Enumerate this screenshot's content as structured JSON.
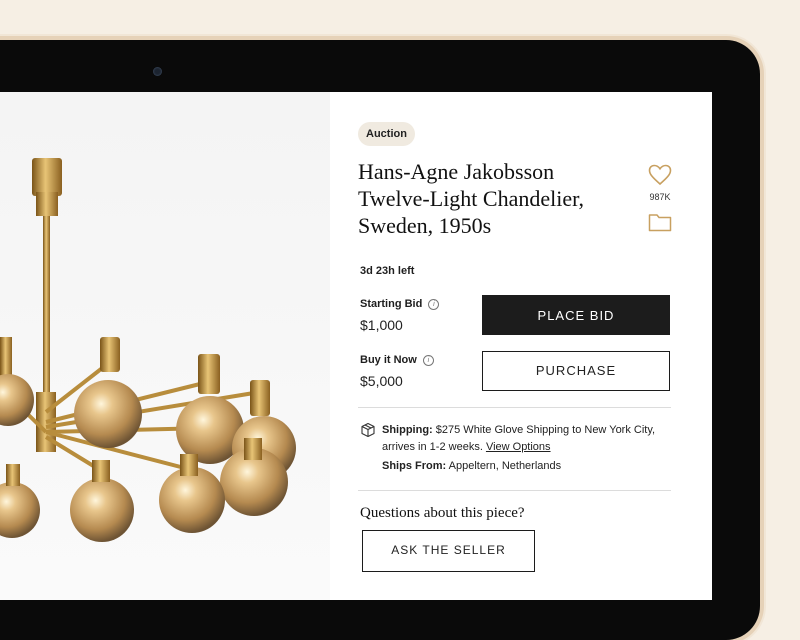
{
  "listing": {
    "badge": "Auction",
    "title_lines": [
      "Hans-Agne Jakobsson",
      "Twelve-Light Chandelier,",
      "Sweden, 1950s"
    ],
    "favorites_count": "987K",
    "time_left": "3d 23h left"
  },
  "bidding": {
    "starting_bid_label": "Starting Bid",
    "starting_bid_value": "$1,000",
    "place_bid_label": "PLACE BID",
    "buy_now_label": "Buy it Now",
    "buy_now_value": "$5,000",
    "purchase_label": "PURCHASE",
    "info_icon": "i"
  },
  "shipping": {
    "label": "Shipping:",
    "text": "$275 White Glove Shipping to New York City, arrives in 1-2 weeks.",
    "link": "View Options",
    "ships_from_label": "Ships From:",
    "ships_from_value": "Appeltern, Netherlands"
  },
  "questions": {
    "heading": "Questions about this piece?",
    "button_label": "ASK THE SELLER"
  },
  "icons": {
    "heart": "heart-icon",
    "folder": "folder-icon",
    "shipping": "package-icon",
    "info": "info-icon"
  },
  "colors": {
    "accent_gold": "#c8a060",
    "dark_button": "#1c1c1c",
    "frame": "#0a0a0a",
    "background": "#f6efe4"
  }
}
